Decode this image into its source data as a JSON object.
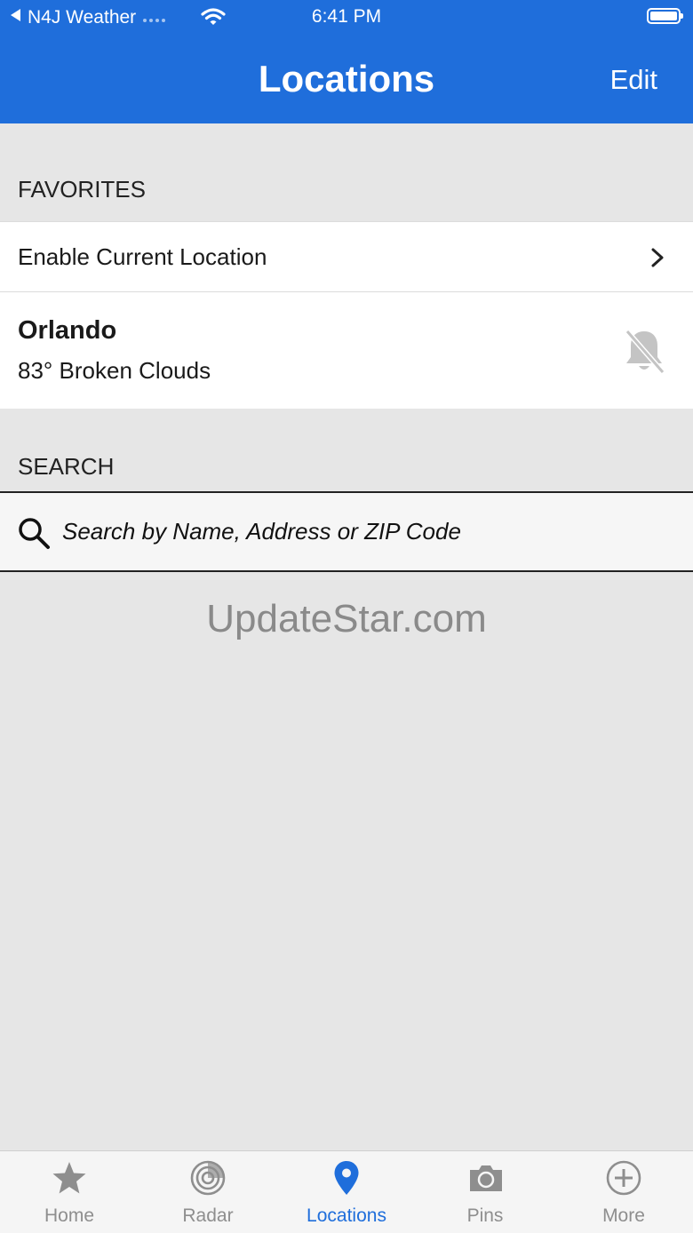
{
  "status_bar": {
    "back_app": "N4J Weather",
    "time": "6:41 PM"
  },
  "nav": {
    "title": "Locations",
    "edit_label": "Edit"
  },
  "favorites": {
    "header": "FAVORITES",
    "enable_location_label": "Enable Current Location",
    "locations": [
      {
        "name": "Orlando",
        "conditions": "83° Broken Clouds",
        "alerts_icon": "bell-muted-icon"
      }
    ]
  },
  "search": {
    "header": "SEARCH",
    "placeholder": "Search by Name, Address or ZIP Code",
    "value": ""
  },
  "watermark": "UpdateStar.com",
  "tabbar": {
    "tabs": [
      {
        "label": "Home",
        "icon": "star-icon"
      },
      {
        "label": "Radar",
        "icon": "radar-icon"
      },
      {
        "label": "Locations",
        "icon": "location-pin-icon",
        "active": true
      },
      {
        "label": "Pins",
        "icon": "camera-icon"
      },
      {
        "label": "More",
        "icon": "plus-circle-icon"
      }
    ],
    "active_color": "#1f6edb",
    "inactive_color": "#8e8e8e"
  },
  "colors": {
    "brand_blue": "#1f6edb",
    "background_gray": "#e6e6e6"
  }
}
